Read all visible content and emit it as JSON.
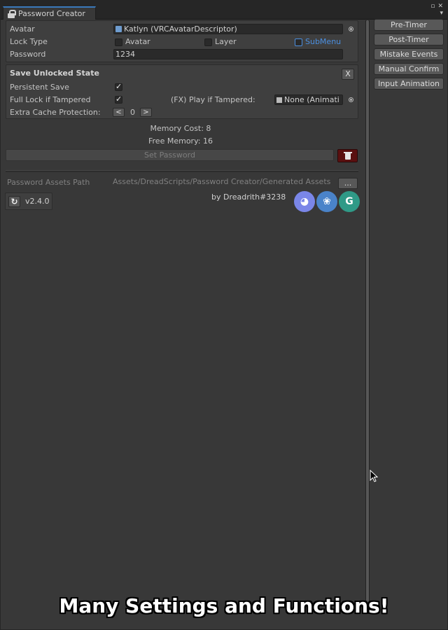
{
  "window": {
    "tab_title": "Password Creator"
  },
  "main": {
    "avatar_label": "Avatar",
    "avatar_value": "Katlyn (VRCAvatarDescriptor)",
    "lock_type_label": "Lock Type",
    "lock_avatar_label": "Avatar",
    "lock_layer_label": "Layer",
    "submenu_label": "SubMenu",
    "password_label": "Password",
    "password_value": "1234"
  },
  "unlock_section": {
    "title": "Save Unlocked State",
    "close_label": "X",
    "persistent_save_label": "Persistent Save",
    "full_lock_label": "Full Lock if Tampered",
    "fx_play_label": "(FX) Play if Tampered:",
    "fx_play_value": "None (Animati",
    "extra_cache_label": "Extra Cache Protection:",
    "extra_cache_dec": "<",
    "extra_cache_value": "0",
    "extra_cache_inc": ">"
  },
  "stats": {
    "memory_cost": "Memory Cost: 8",
    "free_memory": "Free Memory: 16"
  },
  "actions": {
    "set_password": "Set Password"
  },
  "assets": {
    "path_label": "Password Assets Path",
    "path_value": "Assets/DreadScripts/Password Creator/Generated Assets",
    "browse_label": "..."
  },
  "footer": {
    "version": "v2.4.0",
    "byline": "by Dreadrith#3238"
  },
  "sidebar": {
    "buttons": [
      "Pre-Timer",
      "Post-Timer",
      "Mistake Events",
      "Manual Confirm",
      "Input Animation"
    ]
  },
  "caption": "Many Settings and Functions!",
  "colors": {
    "accent": "#3a79bb",
    "submenu_blue": "#4b8fe0",
    "trash_red": "#5a1010",
    "discord": "#7a86e8",
    "github": "#4a83c9",
    "gumroad": "#2f9a87"
  },
  "icons": [
    "lock-icon",
    "avatar-object-icon",
    "animation-clip-icon",
    "refresh-icon",
    "trash-icon",
    "discord-icon",
    "github-icon",
    "gumroad-icon"
  ]
}
